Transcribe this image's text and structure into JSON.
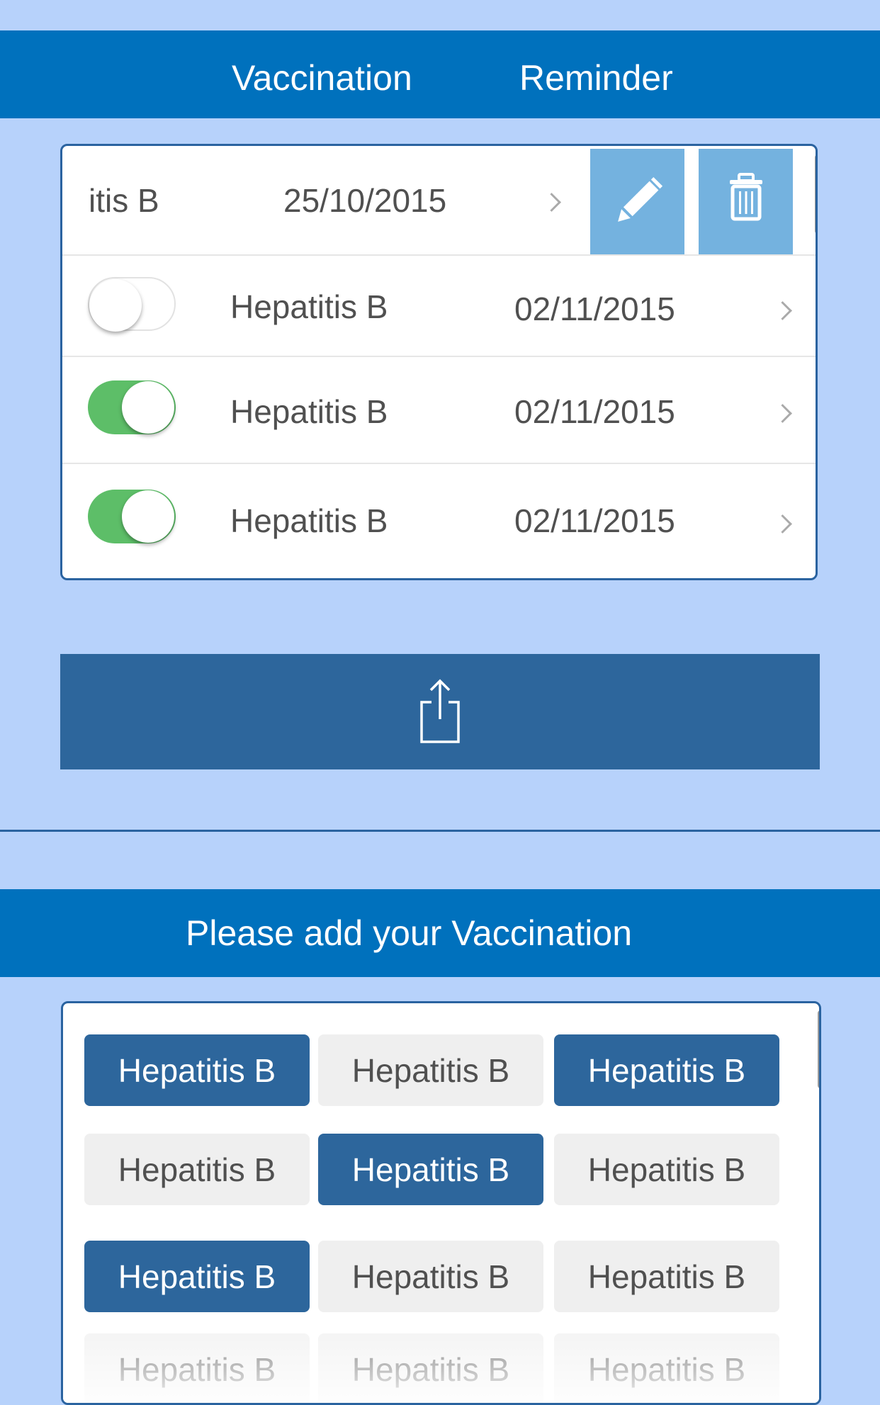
{
  "header": {
    "tab_left": "Vaccination",
    "tab_right": "Reminder"
  },
  "reminders": {
    "swiped_row": {
      "name": "itis B",
      "date": "25/10/2015"
    },
    "rows": [
      {
        "enabled": false,
        "name": "Hepatitis B",
        "date": "02/11/2015"
      },
      {
        "enabled": true,
        "name": "Hepatitis B",
        "date": "02/11/2015"
      },
      {
        "enabled": true,
        "name": "Hepatitis B",
        "date": "02/11/2015"
      }
    ]
  },
  "add_section": {
    "title": "Please add your Vaccination"
  },
  "chips": [
    {
      "label": "Hepatitis B",
      "selected": true
    },
    {
      "label": "Hepatitis B",
      "selected": false
    },
    {
      "label": "Hepatitis B",
      "selected": true
    },
    {
      "label": "Hepatitis B",
      "selected": false
    },
    {
      "label": "Hepatitis B",
      "selected": true
    },
    {
      "label": "Hepatitis B",
      "selected": false
    },
    {
      "label": "Hepatitis B",
      "selected": true
    },
    {
      "label": "Hepatitis B",
      "selected": false
    },
    {
      "label": "Hepatitis B",
      "selected": false
    },
    {
      "label": "Hepatitis B",
      "selected": false
    },
    {
      "label": "Hepatitis B",
      "selected": false
    },
    {
      "label": "Hepatitis B",
      "selected": false
    }
  ],
  "colors": {
    "background": "#b7d2fb",
    "header": "#0071bd",
    "primary": "#2d669c",
    "action_light": "#74b2df",
    "toggle_on": "#5dbe68",
    "chip_unselected": "#efefef"
  },
  "icons": {
    "edit": "pencil-icon",
    "delete": "trash-icon",
    "share": "share-icon",
    "chevron": "chevron-right-icon"
  }
}
